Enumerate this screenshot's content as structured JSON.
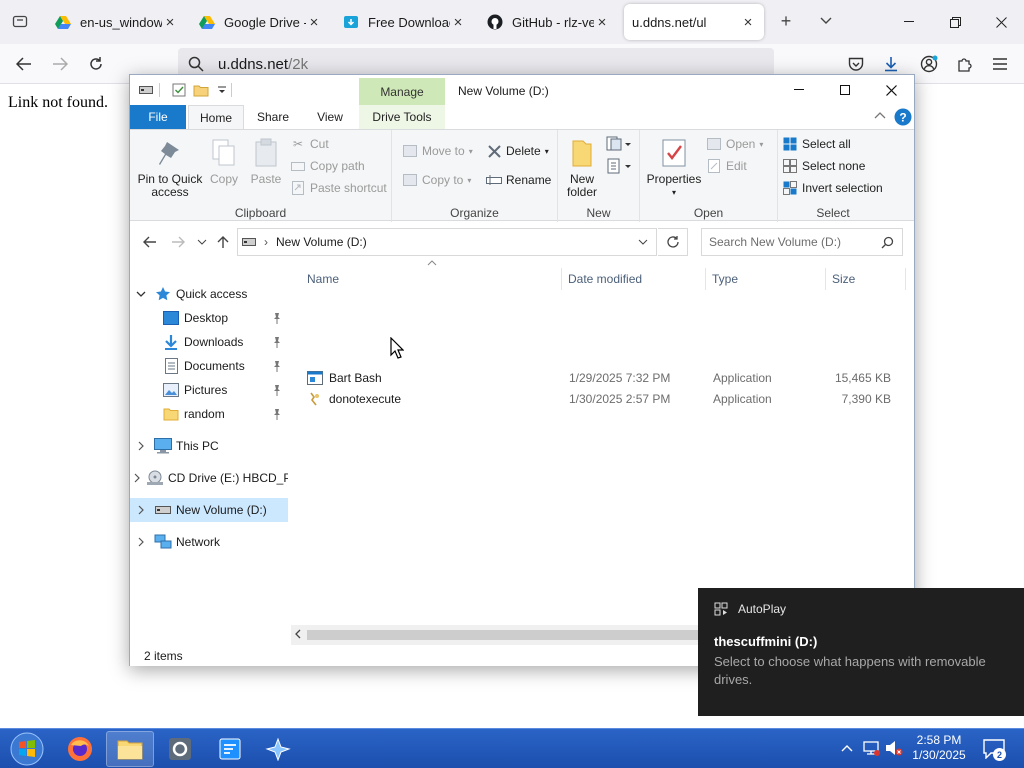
{
  "browser": {
    "tabs": [
      {
        "title": "en-us_windows",
        "favicon": "google-drive-icon",
        "active": false
      },
      {
        "title": "Google Drive - V",
        "favicon": "google-drive-icon",
        "active": false
      },
      {
        "title": "Free Download F",
        "favicon": "download-site-icon",
        "active": false
      },
      {
        "title": "GitHub - rlz-ve/x",
        "favicon": "github-icon",
        "active": false
      },
      {
        "title": "u.ddns.net/ul",
        "favicon": "",
        "active": true
      }
    ],
    "url_host": "u.ddns.net",
    "url_path": "/2k",
    "page_message": "Link not found."
  },
  "explorer": {
    "title": "New Volume (D:)",
    "contextual_tab_header": "Manage",
    "ribbon_tabs": [
      "File",
      "Home",
      "Share",
      "View",
      "Drive Tools"
    ],
    "groups": {
      "clipboard": {
        "label": "Clipboard",
        "pin_line1": "Pin to Quick",
        "pin_line2": "access",
        "copy": "Copy",
        "paste": "Paste",
        "cut": "Cut",
        "copy_path": "Copy path",
        "paste_shortcut": "Paste shortcut"
      },
      "organize": {
        "label": "Organize",
        "move_to": "Move to",
        "copy_to": "Copy to",
        "delete": "Delete",
        "rename": "Rename"
      },
      "new": {
        "label": "New",
        "new_line1": "New",
        "new_line2": "folder"
      },
      "open": {
        "label": "Open",
        "properties": "Properties",
        "open": "Open",
        "edit": "Edit"
      },
      "select": {
        "label": "Select",
        "select_all": "Select all",
        "select_none": "Select none",
        "invert": "Invert selection"
      }
    },
    "address": "New Volume (D:)",
    "search_placeholder": "Search New Volume (D:)",
    "nav": {
      "quick_access": "Quick access",
      "pinned": [
        "Desktop",
        "Downloads",
        "Documents",
        "Pictures",
        "random"
      ],
      "this_pc": "This PC",
      "cd_drive": "CD Drive (E:) HBCD_P",
      "new_volume": "New Volume (D:)",
      "network": "Network"
    },
    "columns": {
      "name": "Name",
      "date": "Date modified",
      "type": "Type",
      "size": "Size"
    },
    "files": [
      {
        "name": "Bart Bash",
        "date": "1/29/2025 7:32 PM",
        "type": "Application",
        "size": "15,465 KB"
      },
      {
        "name": "donotexecute",
        "date": "1/30/2025 2:57 PM",
        "type": "Application",
        "size": "7,390 KB"
      }
    ],
    "status": "2 items"
  },
  "notification": {
    "app": "AutoPlay",
    "title": "thescuffmini (D:)",
    "message": "Select to choose what happens with removable drives."
  },
  "taskbar": {
    "time": "2:58 PM",
    "date": "1/30/2025",
    "notification_count": "2"
  }
}
